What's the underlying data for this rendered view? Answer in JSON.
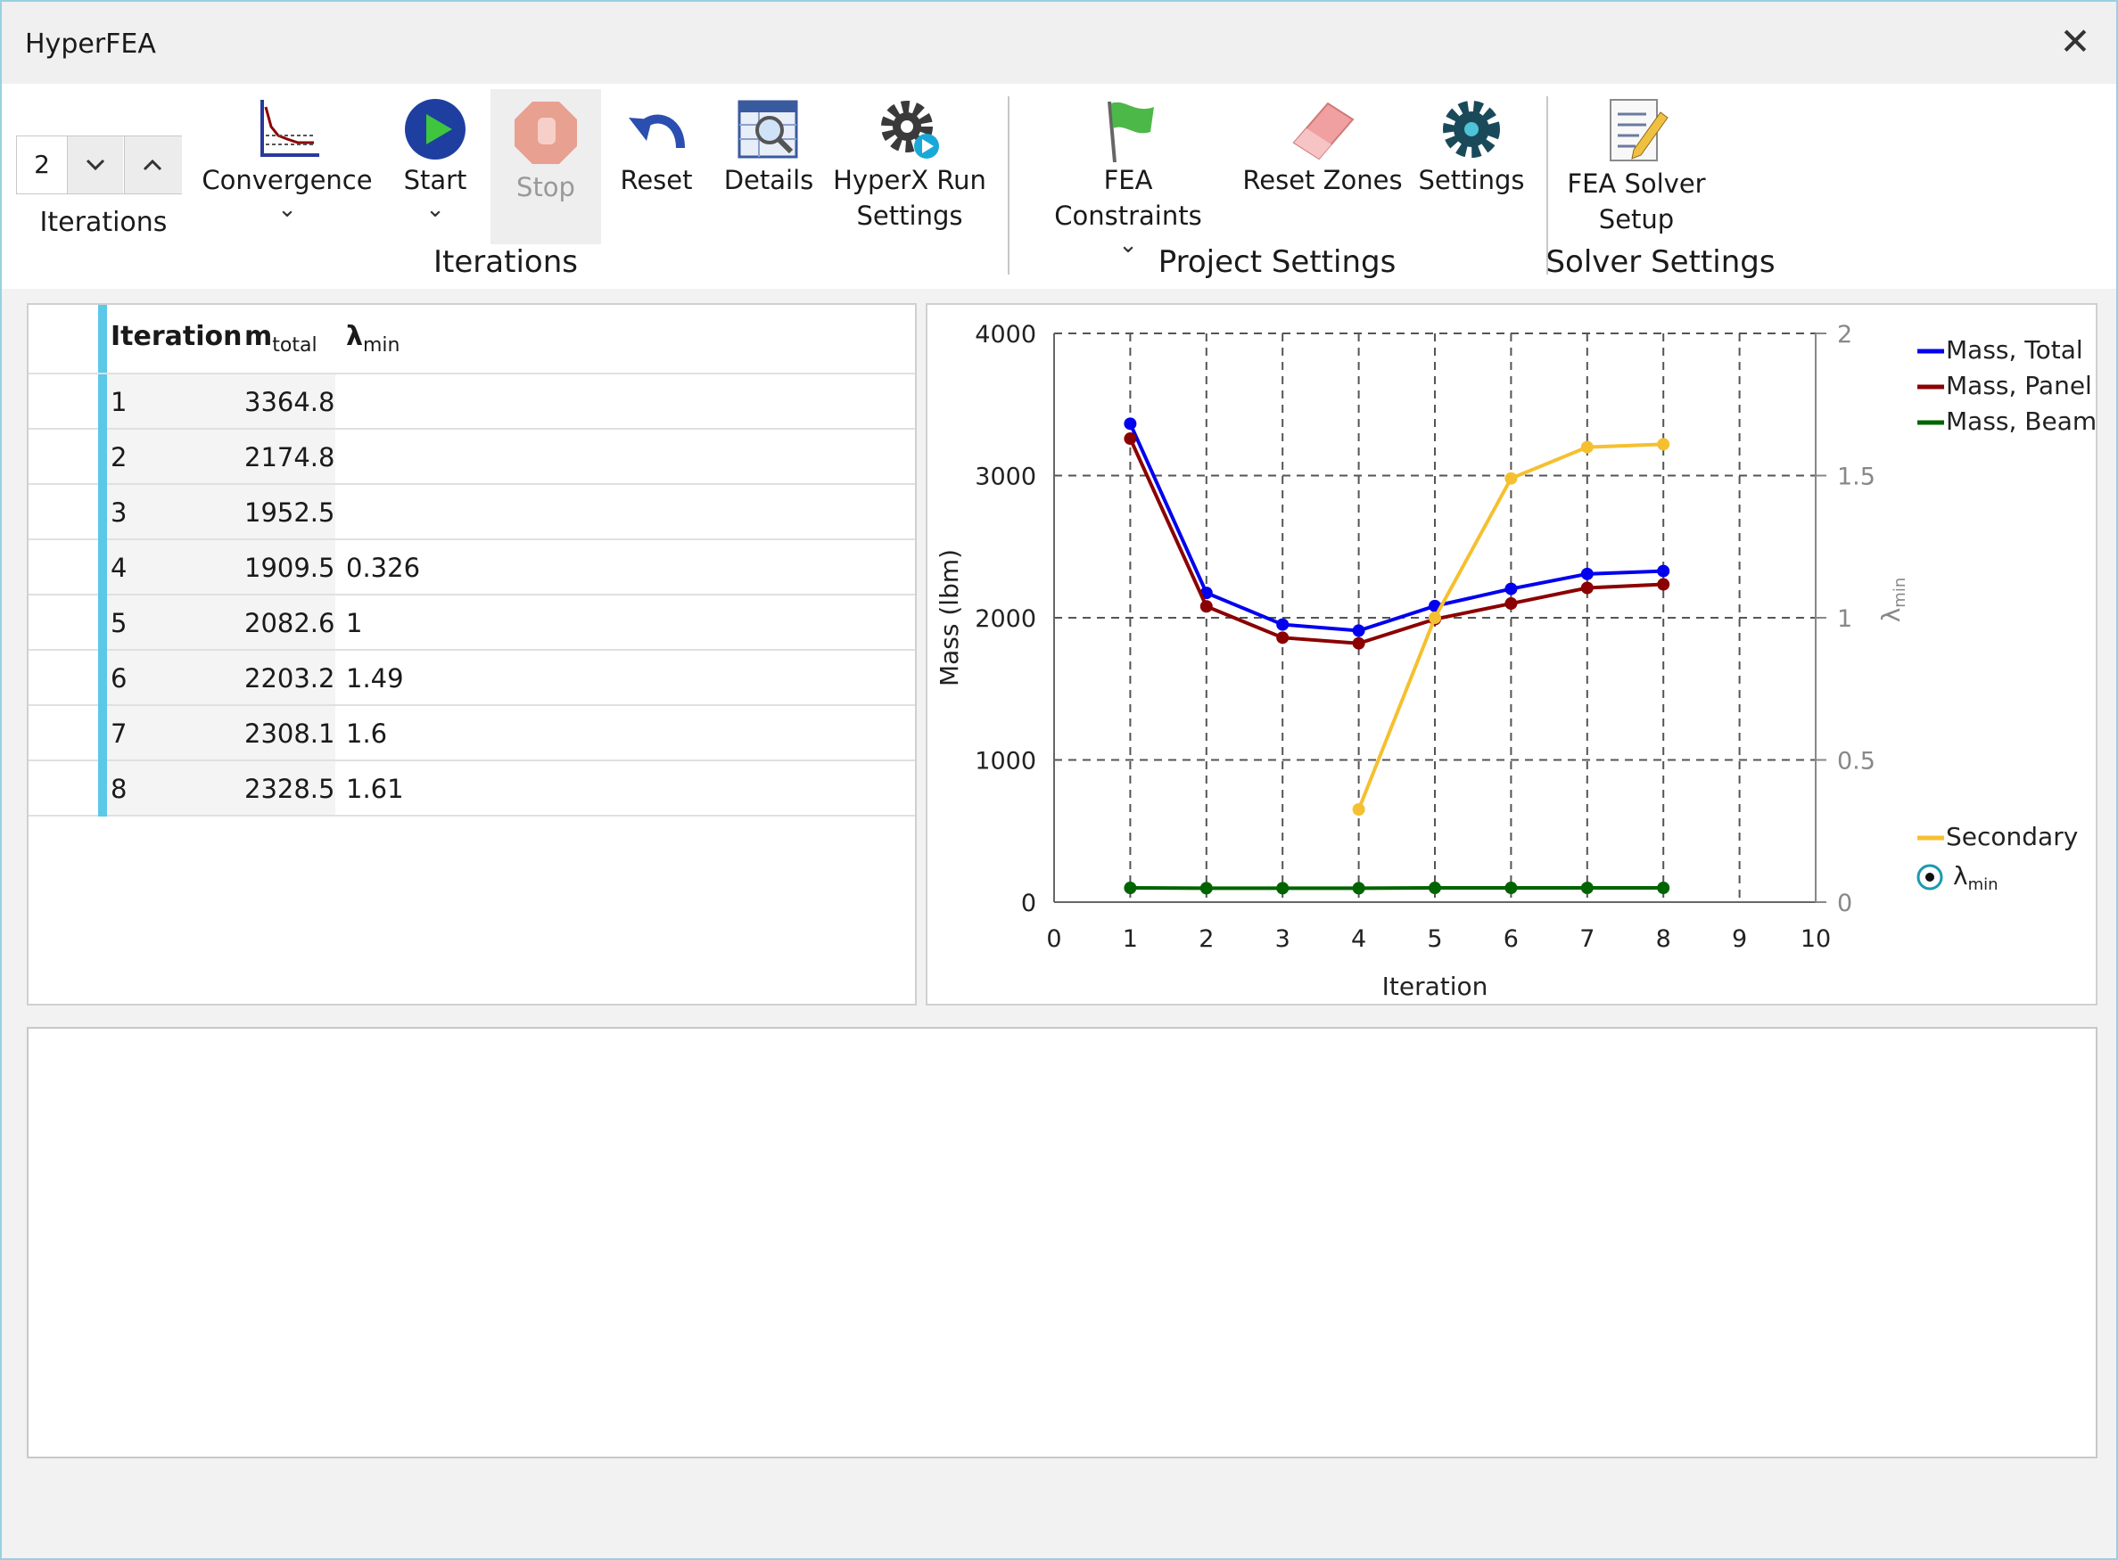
{
  "window": {
    "title": "HyperFEA",
    "close_label": "✕"
  },
  "ribbon": {
    "iterations_value": "2",
    "iterations_label": "Iterations",
    "buttons": {
      "convergence": "Convergence",
      "start": "Start",
      "stop": "Stop",
      "reset": "Reset",
      "details": "Details",
      "hyperx_line1": "HyperX Run",
      "hyperx_line2": "Settings",
      "fea_constraints": "FEA Constraints",
      "reset_zones": "Reset Zones",
      "settings": "Settings",
      "fea_solver_line1": "FEA Solver",
      "fea_solver_line2": "Setup"
    },
    "groups": {
      "iterations": "Iterations",
      "project_settings": "Project Settings",
      "solver_settings": "Solver Settings"
    }
  },
  "table": {
    "headers": {
      "iteration": "Iteration",
      "mass_base": "m",
      "mass_sub": "total",
      "lambda_base": "λ",
      "lambda_sub": "min"
    },
    "rows": [
      {
        "iteration": "1",
        "mass": "3364.8",
        "lambda": ""
      },
      {
        "iteration": "2",
        "mass": "2174.8",
        "lambda": ""
      },
      {
        "iteration": "3",
        "mass": "1952.5",
        "lambda": ""
      },
      {
        "iteration": "4",
        "mass": "1909.5",
        "lambda": "0.326"
      },
      {
        "iteration": "5",
        "mass": "2082.6",
        "lambda": "1"
      },
      {
        "iteration": "6",
        "mass": "2203.2",
        "lambda": "1.49"
      },
      {
        "iteration": "7",
        "mass": "2308.1",
        "lambda": "1.6"
      },
      {
        "iteration": "8",
        "mass": "2328.5",
        "lambda": "1.61"
      }
    ]
  },
  "chart_data": {
    "type": "line",
    "title": "",
    "xlabel": "Iteration",
    "ylabel": "Mass (lbm)",
    "y2label_base": "λ",
    "y2label_sub": "min",
    "xlim": [
      0,
      10
    ],
    "ylim": [
      0,
      4000
    ],
    "y2lim": [
      0,
      2
    ],
    "xticks": [
      "0",
      "1",
      "2",
      "3",
      "4",
      "5",
      "6",
      "7",
      "8",
      "9",
      "10"
    ],
    "yticks": [
      "0",
      "1000",
      "2000",
      "3000",
      "4000"
    ],
    "y2ticks": [
      "0",
      "0.5",
      "1",
      "1.5",
      "2"
    ],
    "grid": true,
    "legend_primary": "top-right",
    "legend_secondary_title": "Secondary",
    "secondary_marker_label_base": "λ",
    "secondary_marker_label_sub": "min",
    "series": [
      {
        "name": "Mass, Total",
        "color": "#0000ee",
        "axis": "left",
        "x": [
          1,
          2,
          3,
          4,
          5,
          6,
          7,
          8
        ],
        "y": [
          3364.8,
          2174.8,
          1952.5,
          1909.5,
          2082.6,
          2203.2,
          2308.1,
          2328.5
        ]
      },
      {
        "name": "Mass, Panel",
        "color": "#8b0000",
        "axis": "left",
        "x": [
          1,
          2,
          3,
          4,
          5,
          6,
          7,
          8
        ],
        "y": [
          3260,
          2080,
          1860,
          1820,
          1990,
          2100,
          2210,
          2235
        ]
      },
      {
        "name": "Mass, Beam",
        "color": "#006400",
        "axis": "left",
        "x": [
          1,
          2,
          3,
          4,
          5,
          6,
          7,
          8
        ],
        "y": [
          100,
          98,
          98,
          98,
          100,
          100,
          100,
          100
        ]
      },
      {
        "name": "λmin",
        "color": "#f5c030",
        "axis": "right",
        "x": [
          4,
          5,
          6,
          7,
          8
        ],
        "y": [
          0.326,
          1,
          1.49,
          1.6,
          1.61
        ]
      }
    ]
  }
}
